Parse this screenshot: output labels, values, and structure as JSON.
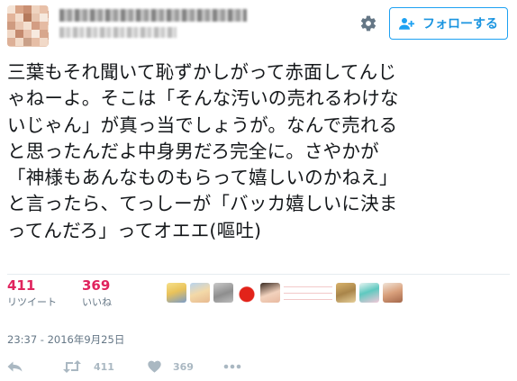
{
  "user": {
    "display_name": "",
    "handle": ""
  },
  "header": {
    "follow_label": "フォローする"
  },
  "tweet": {
    "text": "三葉もそれ聞いて恥ずかしがって赤面してんじ\nゃねーよ。そこは「そんな汚いの売れるわけな\nいじゃん」が真っ当でしょうが。なんで売れる\nと思ったんだよ中身男だろ完全に。さやかが\n「神様もあんなものもらって嬉しいのかねえ」\nと言ったら、てっしーが「バッカ嬉しいに決ま\nってんだろ」ってオエエ(嘔吐)",
    "timestamp": "23:37 - 2016年9月25日"
  },
  "stats": {
    "retweets": {
      "count": "411",
      "label": "リツイート"
    },
    "likes": {
      "count": "369",
      "label": "いいね"
    }
  },
  "actions": {
    "retweet_count": "411",
    "like_count": "369"
  },
  "colors": {
    "accent": "#1da1f2",
    "like_red": "#e0245e",
    "muted": "#657786",
    "icon_gray": "#aab8c2"
  },
  "icons": [
    "gear-icon",
    "follow-person-icon",
    "reply-icon",
    "retweet-icon",
    "heart-icon",
    "more-icon"
  ]
}
